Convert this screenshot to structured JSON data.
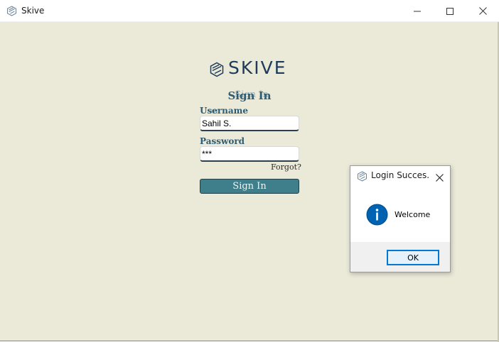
{
  "window": {
    "title": "Skive",
    "icon": "skive-logo-icon",
    "controls": [
      "minimize-icon",
      "maximize-icon",
      "close-icon"
    ]
  },
  "logo": {
    "text": "SKIVE",
    "color": "#1f3b5c"
  },
  "form": {
    "heading": "Sign In",
    "heading_ghost": "Sign In",
    "username_label": "Username",
    "username_ghost": "User",
    "username_value": "Sahil S.",
    "password_label": "Password",
    "password_value": "***",
    "forgot_link": "Forgot?",
    "signin_button": "Sign In"
  },
  "dialog": {
    "title": "Login Succes...",
    "message": "Welcome",
    "ok_button": "OK",
    "icon": "info-icon"
  },
  "colors": {
    "background": "#ebe9d8",
    "accent": "#3f7f8b",
    "label": "#2e5c72",
    "focus": "#0078d7"
  }
}
